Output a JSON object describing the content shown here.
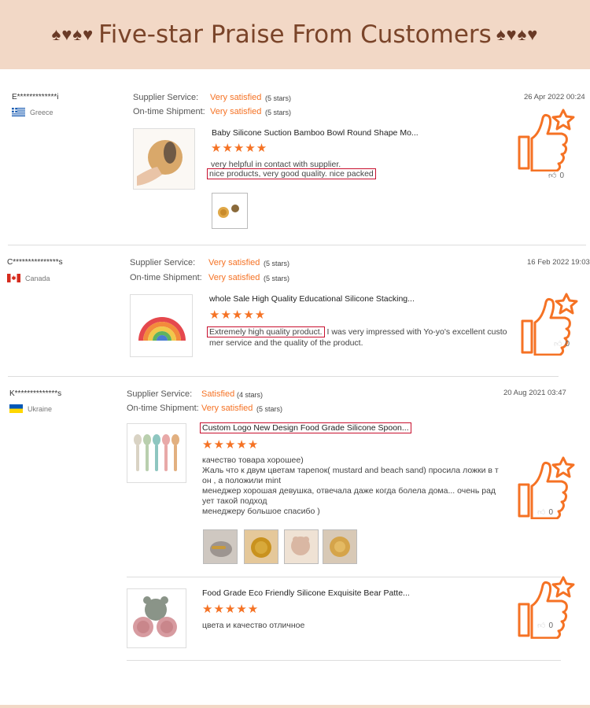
{
  "banner": {
    "hearts_left": "♠♥♠♥",
    "title": "Five-star Praise From Customers",
    "hearts_right": "♠♥♠♥"
  },
  "labels": {
    "supplier_service": "Supplier Service:",
    "on_time_shipment": "On-time Shipment:"
  },
  "colors": {
    "accent": "#f57224",
    "banner_bg": "#f2d8c6",
    "banner_text": "#7a4429",
    "highlight": "#c8102e"
  },
  "reviews": [
    {
      "user": "E*************i",
      "country": "Greece",
      "supplier_service": "Very satisfied",
      "supplier_stars": "(5 stars)",
      "shipment": "Very satisfied",
      "shipment_stars": "(5 stars)",
      "date": "26 Apr 2022 00:24",
      "product": "Baby Silicone Suction Bamboo Bowl Round Shape Mo...",
      "rating": 5,
      "comment_line1": "very helpful in contact with supplier.",
      "comment_highlight": "nice products, very good quality. nice packed",
      "likes": "0"
    },
    {
      "user": "C***************s",
      "country": "Canada",
      "supplier_service": "Very satisfied",
      "supplier_stars": "(5 stars)",
      "shipment": "Very satisfied",
      "shipment_stars": "(5 stars)",
      "date": "16 Feb 2022 19:03",
      "product": "whole Sale High Quality Educational Silicone Stacking...",
      "rating": 5,
      "comment_highlight": "Extremely high quality product.",
      "comment_rest1": " I was very impressed with Yo-yo's excellent custo",
      "comment_rest2": "mer service and the quality of the product.",
      "likes": "0"
    },
    {
      "user": "K**************s",
      "country": "Ukraine",
      "supplier_service": "Satisfied",
      "supplier_stars": "(4 stars)",
      "shipment": "Very satisfied",
      "shipment_stars": "(5 stars)",
      "date": "20 Aug 2021 03:47",
      "product": "Custom Logo New Design Food Grade Silicone Spoon...",
      "rating": 5,
      "comment_lines": [
        "качество товара хорошее)",
        "Жаль что к двум цветам тарепок( mustard and beach sand) просила ложки в т",
        "он , а положили mint",
        "менеджер хорошая девушка, отвечала даже когда болела дома... очень рад",
        "ует такой подход",
        "менеджеру большое спасибо )"
      ],
      "likes": "0",
      "product2": "Food Grade Eco Friendly Silicone Exquisite Bear Patte...",
      "rating2": 5,
      "comment2": "цвета и качество отличное",
      "likes2": "0"
    }
  ]
}
